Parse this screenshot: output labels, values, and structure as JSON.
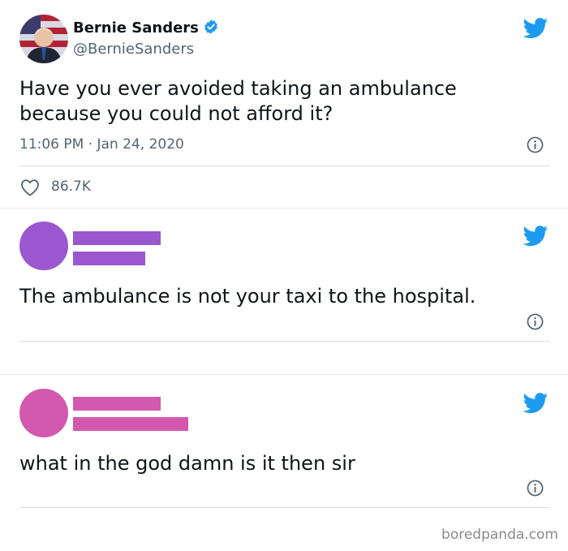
{
  "tweets": [
    {
      "name": "Bernie Sanders",
      "handle": "@BernieSanders",
      "text": "Have you ever avoided taking an ambulance because you could not afford it?",
      "timestamp": "11:06 PM · Jan 24, 2020",
      "likes": "86.7K",
      "verified": true
    },
    {
      "text": "The ambulance is not your taxi to the hospital.",
      "avatar_color": "#9b57cf",
      "redaction_color": "#9b57cf"
    },
    {
      "text": "what in the god damn is it then sir",
      "avatar_color": "#d259ad",
      "redaction_color": "#d259ad"
    }
  ],
  "icons": {
    "brand": "twitter-bird-icon",
    "verified": "verified-badge-icon",
    "info": "info-icon",
    "like": "heart-icon"
  },
  "colors": {
    "twitter_blue": "#1d9bf0",
    "secondary_text": "#536471"
  },
  "watermark": "boredpanda.com"
}
